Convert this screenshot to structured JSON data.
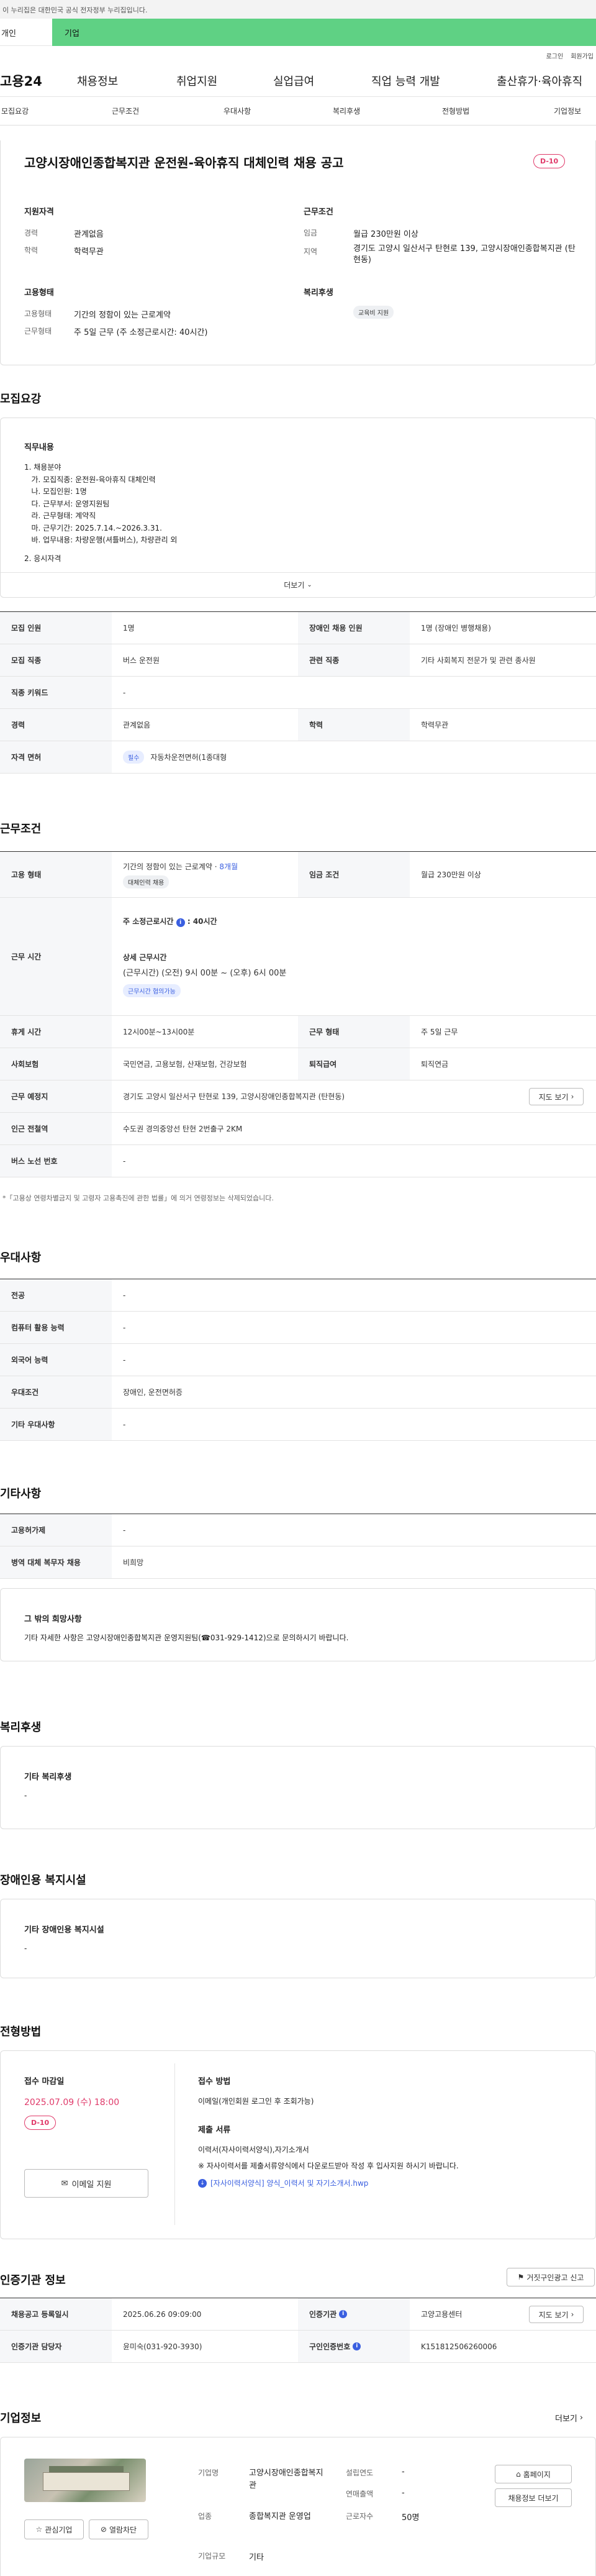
{
  "gov_notice": "이 누리집은 대한민국 공식 전자정부 누리집입니다.",
  "top_tabs": [
    "개인",
    "기업"
  ],
  "util": [
    "로그인",
    "회원가입"
  ],
  "logo": "고용24",
  "gnb": [
    "채용정보",
    "취업지원",
    "실업급여",
    "직업 능력 개발",
    "출산휴가·육아휴직"
  ],
  "subnav": [
    "모집요강",
    "근무조건",
    "우대사항",
    "복리후생",
    "전형방법",
    "기업정보"
  ],
  "job": {
    "title": "고양시장애인종합복지관 운전원-육아휴직 대체인력 채용 공고",
    "dday": "D-10",
    "qual_title": "지원자격",
    "qual": [
      {
        "label": "경력",
        "value": "관계없음"
      },
      {
        "label": "학력",
        "value": "학력무관"
      }
    ],
    "work_title": "근무조건",
    "work": [
      {
        "label": "임금",
        "value": "월급 230만원 이상"
      },
      {
        "label": "지역",
        "value": "경기도 고양시 일산서구 탄현로 139, 고양시장애인종합복지관 (탄현동)"
      }
    ],
    "emp_title": "고용형태",
    "emp": [
      {
        "label": "고용형태",
        "value": "기간의 정함이 있는 근로계약"
      },
      {
        "label": "근무형태",
        "value": "주 5일 근무 (주 소정근로시간: 40시간)"
      }
    ],
    "welfare_title": "복리후생",
    "welfare_chip": "교육비 지원"
  },
  "recruit": {
    "title": "모집요강",
    "duty_title": "직무내용",
    "duty_lines": [
      "1. 채용분야",
      "   가. 모집직종: 운전원-육아휴직 대체인력",
      "   나. 모집인원: 1명",
      "   다. 근무부서: 운영지원팀",
      "   라. 근무형태: 계약직",
      "   마. 근무기간: 2025.7.14.~2026.3.31.",
      "   바. 업무내용: 차량운행(셔틀버스), 차량관리 외",
      "2. 응시자격"
    ],
    "more": "더보기",
    "rows": [
      {
        "th1": "모집 인원",
        "td1": "1명",
        "th2": "장애인 채용 인원",
        "td2": "1명 (장애인 병행채용)"
      },
      {
        "th1": "모집 직종",
        "td1": "버스 운전원",
        "th2": "관련 직종",
        "td2": "기타 사회복지 전문가 및 관련 종사원"
      },
      {
        "th1": "직종 키워드",
        "td1": "-"
      },
      {
        "th1": "경력",
        "td1": "관계없음",
        "th2": "학력",
        "td2": "학력무관"
      },
      {
        "th1": "자격 면허",
        "chip": "필수",
        "td1": "자동차운전면허(1종대형"
      }
    ]
  },
  "cond": {
    "title": "근무조건",
    "emp_type_label": "고용 형태",
    "emp_type_value": "기간의 정함이 있는 근로계약",
    "emp_type_period": "8개월",
    "emp_type_chip": "대체인력 채용",
    "wage_label": "임금 조건",
    "wage_value": "월급 230만원 이상",
    "time_label": "근무 시간",
    "time_weekly": "주 소정근로시간",
    "time_weekly_val": "40시간",
    "time_detail_title": "상세 근무시간",
    "time_detail": "(근무시간) (오전) 9시 00분 ~ (오후) 6시 00분",
    "time_chip": "근무시간 협의가능",
    "rows": [
      {
        "th1": "휴게 시간",
        "td1": "12시00분~13시00분",
        "th2": "근무 형태",
        "td2": "주 5일 근무"
      },
      {
        "th1": "사회보험",
        "td1": "국민연금, 고용보험, 산재보험, 건강보험",
        "th2": "퇴직급여",
        "td2": "퇴직연금"
      }
    ],
    "place_label": "근무 예정지",
    "place_value": "경기도 고양시 일산서구 탄현로 139, 고양시장애인종합복지관 (탄현동)",
    "map_btn": "지도 보기",
    "subway_label": "인근 전철역",
    "subway_value": "수도권 경의중앙선 탄현 2번출구 2KM",
    "bus_label": "버스 노선 번호",
    "bus_value": "-",
    "note": "*「고용상 연령차별금지 및 고령자 고용촉진에 관한 법률」에 의거 연령정보는 삭제되었습니다."
  },
  "pref": {
    "title": "우대사항",
    "rows": [
      {
        "th": "전공",
        "td": "-"
      },
      {
        "th": "컴퓨터 활용 능력",
        "td": "-"
      },
      {
        "th": "외국어 능력",
        "td": "-"
      },
      {
        "th": "우대조건",
        "td": "장애인, 운전면허증"
      },
      {
        "th": "기타 우대사항",
        "td": "-"
      }
    ]
  },
  "etc": {
    "title": "기타사항",
    "rows": [
      {
        "th": "고용허가제",
        "td": "-"
      },
      {
        "th": "병역 대체 복무자 채용",
        "td": "비희망"
      }
    ],
    "box_title": "그 밖의 희망사항",
    "box_text": "기타 자세한 사항은 고양시장애인종합복지관 운영지원팀(☎031-929-1412)으로 문의하시기 바랍니다."
  },
  "benefit": {
    "title": "복리후생",
    "box_title": "기타 복리후생",
    "box_text": "-"
  },
  "facility": {
    "title": "장애인용 복지시설",
    "box_title": "기타 장애인용 복지시설",
    "box_text": "-"
  },
  "process": {
    "title": "전형방법",
    "deadline_label": "접수 마감일",
    "deadline": "2025.07.09 (수) 18:00",
    "dday": "D-10",
    "apply_btn": "이메일 지원",
    "method_label": "접수 방법",
    "method": "이메일(개인회원 로그인 후 조회가능)",
    "docs_label": "제출 서류",
    "docs": "이력서(자사이력서양식),자기소개서",
    "docs_note": "※ 자사이력서를 제출서류양식에서 다운로드받아 작성 후 입사지원 하시기 바랍니다.",
    "file": "[자사이력서양식] 양식_이력서 및 자기소개서.hwp"
  },
  "auth": {
    "title": "인증기관 정보",
    "report_btn": "거짓구인광고 신고",
    "rows": [
      {
        "th1": "채용공고 등록일시",
        "td1": "2025.06.26 09:09:00",
        "th2": "인증기관",
        "td2": "고양고용센터",
        "btn": "지도 보기"
      },
      {
        "th1": "인증기관 담당자",
        "td1": "윤미숙(031-920-3930)",
        "th2": "구인인증번호",
        "td2": "K151812506260006"
      }
    ]
  },
  "company": {
    "title": "기업정보",
    "more": "더보기",
    "fav_btn": "관심기업",
    "block_btn": "열람차단",
    "name_label": "기업명",
    "name": "고양시장애인종합복지관",
    "industry_label": "업종",
    "industry": "종합복지관 운영업",
    "size_label": "기업규모",
    "size": "기타",
    "year_label": "설립연도",
    "year": "-",
    "revenue_label": "연매출액",
    "revenue": "-",
    "staff_label": "근로자수",
    "staff": "50명",
    "home_btn": "홈페이지",
    "jobs_btn": "채용정보 더보기"
  }
}
